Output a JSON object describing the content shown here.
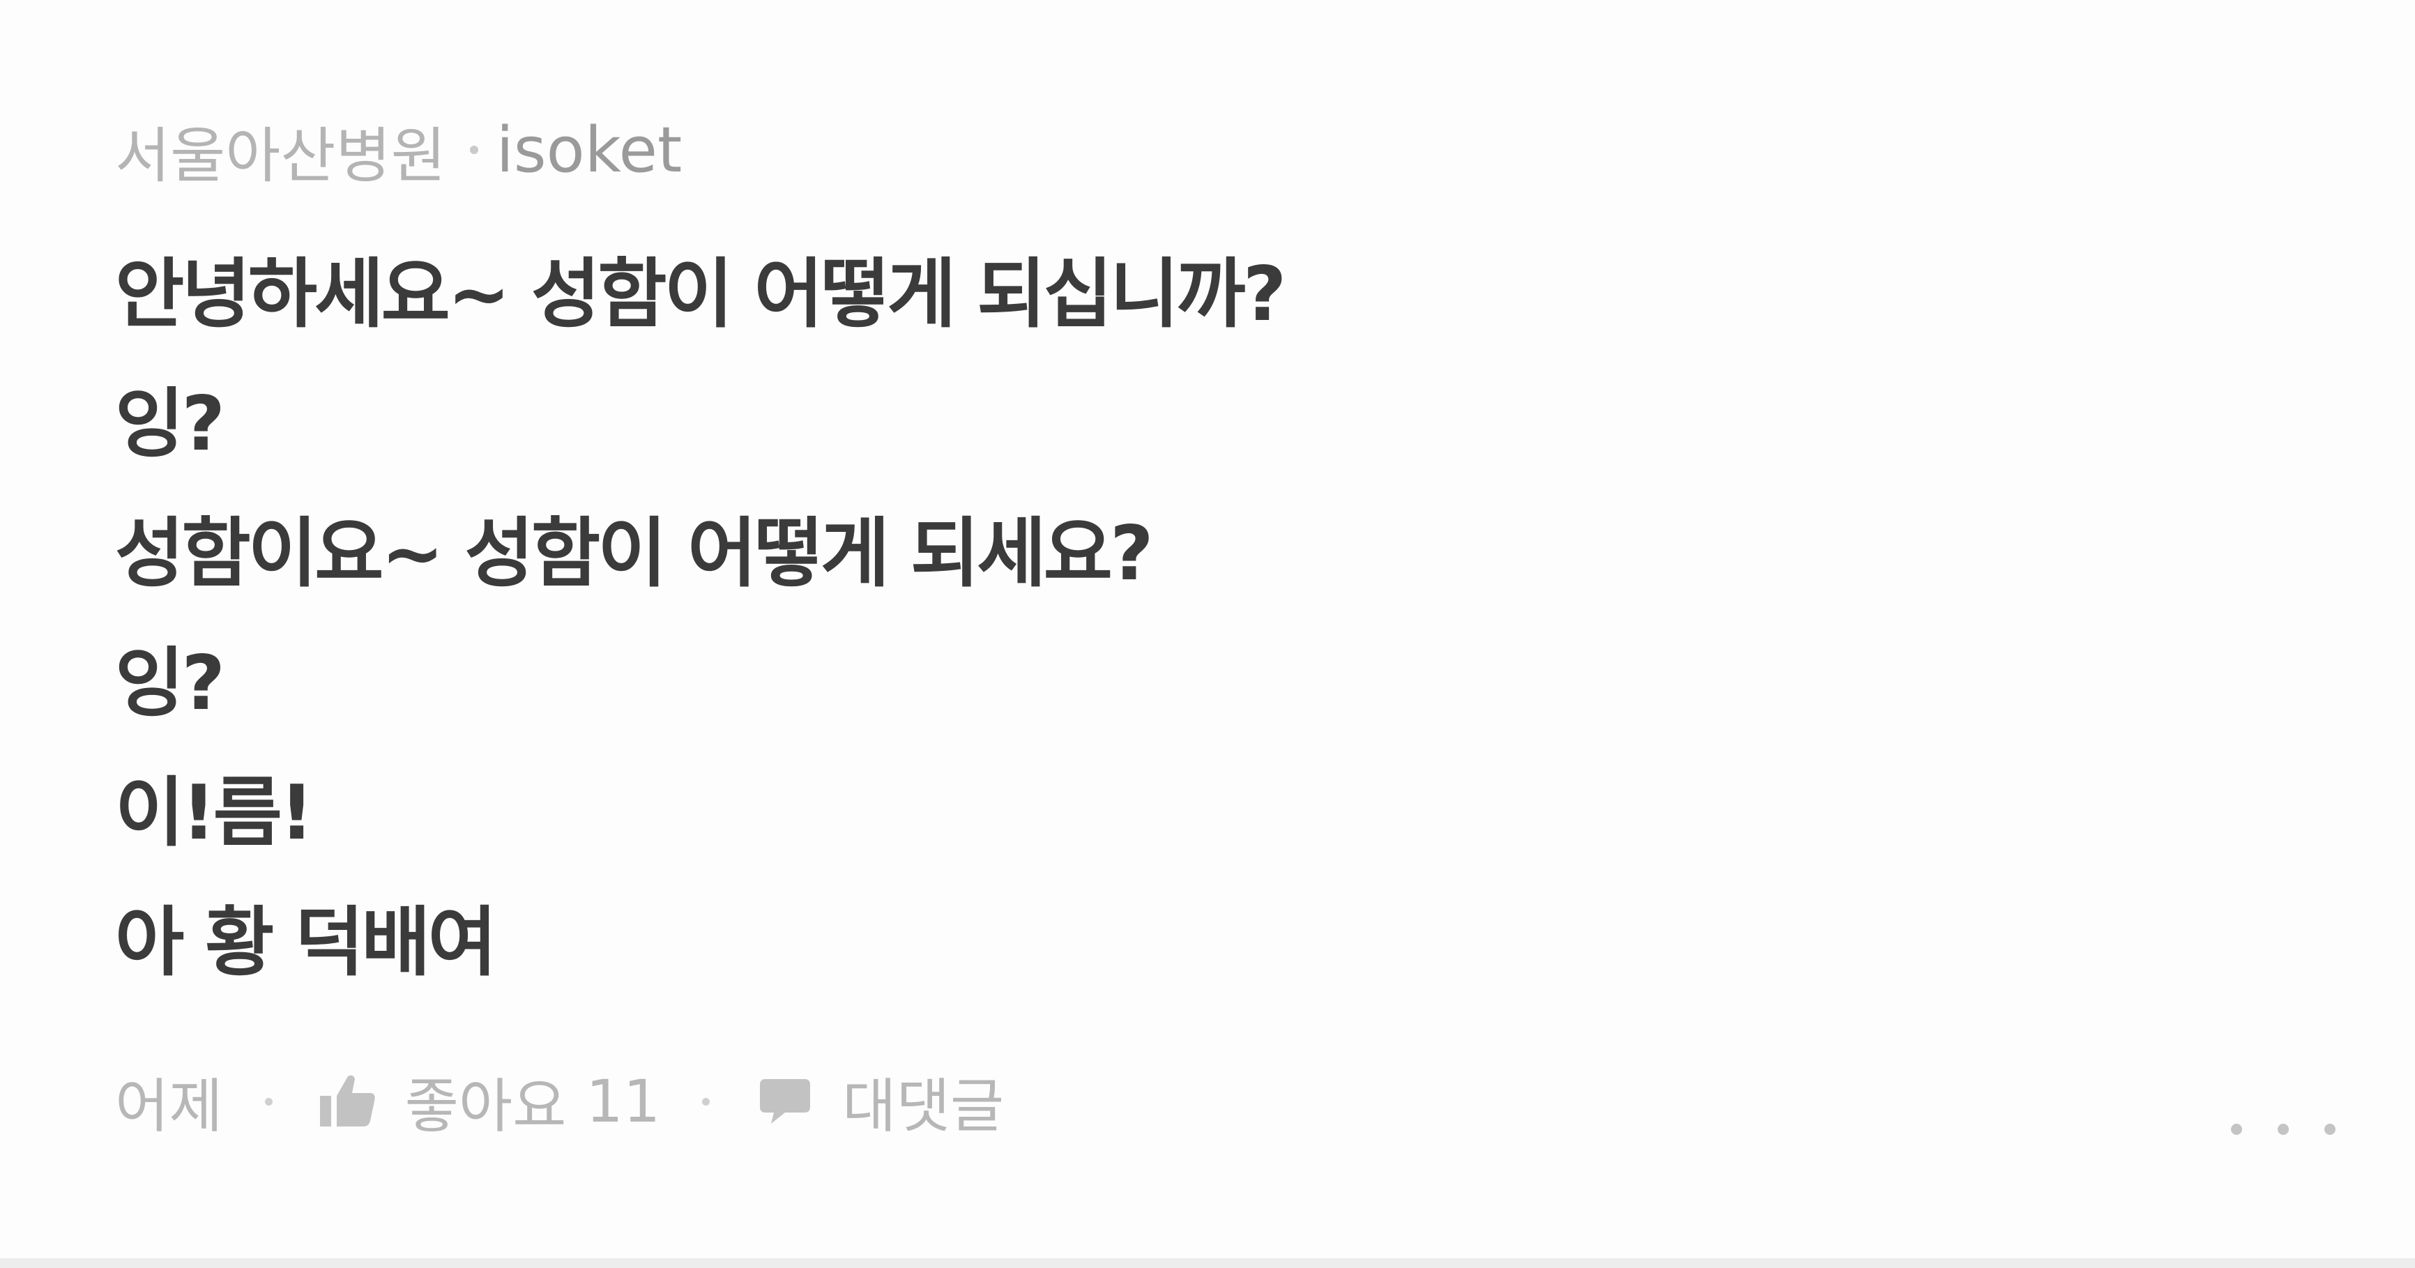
{
  "comment": {
    "source": "서울아산병원",
    "nickname": "isoket",
    "lines": [
      "안녕하세요~ 성함이 어떻게 되십니까?",
      "잉?",
      "성함이요~ 성함이 어떻게 되세요?",
      "잉?",
      "이!름!",
      "아 황 덕배여"
    ]
  },
  "footer": {
    "time": "어제",
    "like_label": "좋아요",
    "like_count": "11",
    "reply_label": "대댓글",
    "like_icon": "thumbs-up-icon",
    "reply_icon": "speech-bubble-icon",
    "more_icon": "more-dots-icon"
  }
}
